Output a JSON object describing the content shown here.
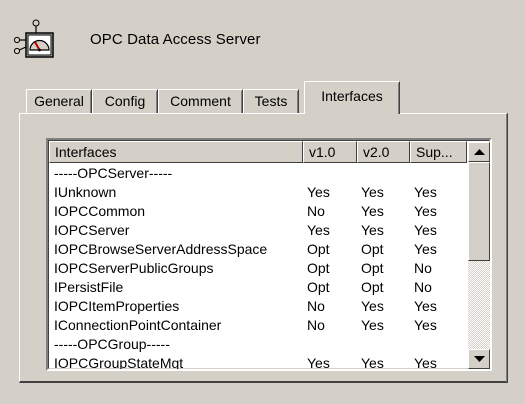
{
  "window": {
    "title": "OPC Data Access Server",
    "icon": "server-gauge-icon"
  },
  "tabs": [
    {
      "label": "General",
      "active": false
    },
    {
      "label": "Config",
      "active": false
    },
    {
      "label": "Comment",
      "active": false
    },
    {
      "label": "Tests",
      "active": false
    },
    {
      "label": "Interfaces",
      "active": true
    }
  ],
  "list": {
    "columns": [
      "Interfaces",
      "v1.0",
      "v2.0",
      "Sup..."
    ],
    "rows": [
      {
        "name": "-----OPCServer-----",
        "v1": "",
        "v2": "",
        "sup": ""
      },
      {
        "name": "IUnknown",
        "v1": "Yes",
        "v2": "Yes",
        "sup": "Yes"
      },
      {
        "name": "IOPCCommon",
        "v1": "No",
        "v2": "Yes",
        "sup": "Yes"
      },
      {
        "name": "IOPCServer",
        "v1": "Yes",
        "v2": "Yes",
        "sup": "Yes"
      },
      {
        "name": "IOPCBrowseServerAddressSpace",
        "v1": "Opt",
        "v2": "Opt",
        "sup": "Yes"
      },
      {
        "name": "IOPCServerPublicGroups",
        "v1": "Opt",
        "v2": "Opt",
        "sup": "No"
      },
      {
        "name": "IPersistFile",
        "v1": "Opt",
        "v2": "Opt",
        "sup": "No"
      },
      {
        "name": "IOPCItemProperties",
        "v1": "No",
        "v2": "Yes",
        "sup": "Yes"
      },
      {
        "name": "IConnectionPointContainer",
        "v1": "No",
        "v2": "Yes",
        "sup": "Yes"
      },
      {
        "name": "-----OPCGroup-----",
        "v1": "",
        "v2": "",
        "sup": ""
      },
      {
        "name": "IOPCGroupStateMgt",
        "v1": "Yes",
        "v2": "Yes",
        "sup": "Yes"
      }
    ]
  }
}
